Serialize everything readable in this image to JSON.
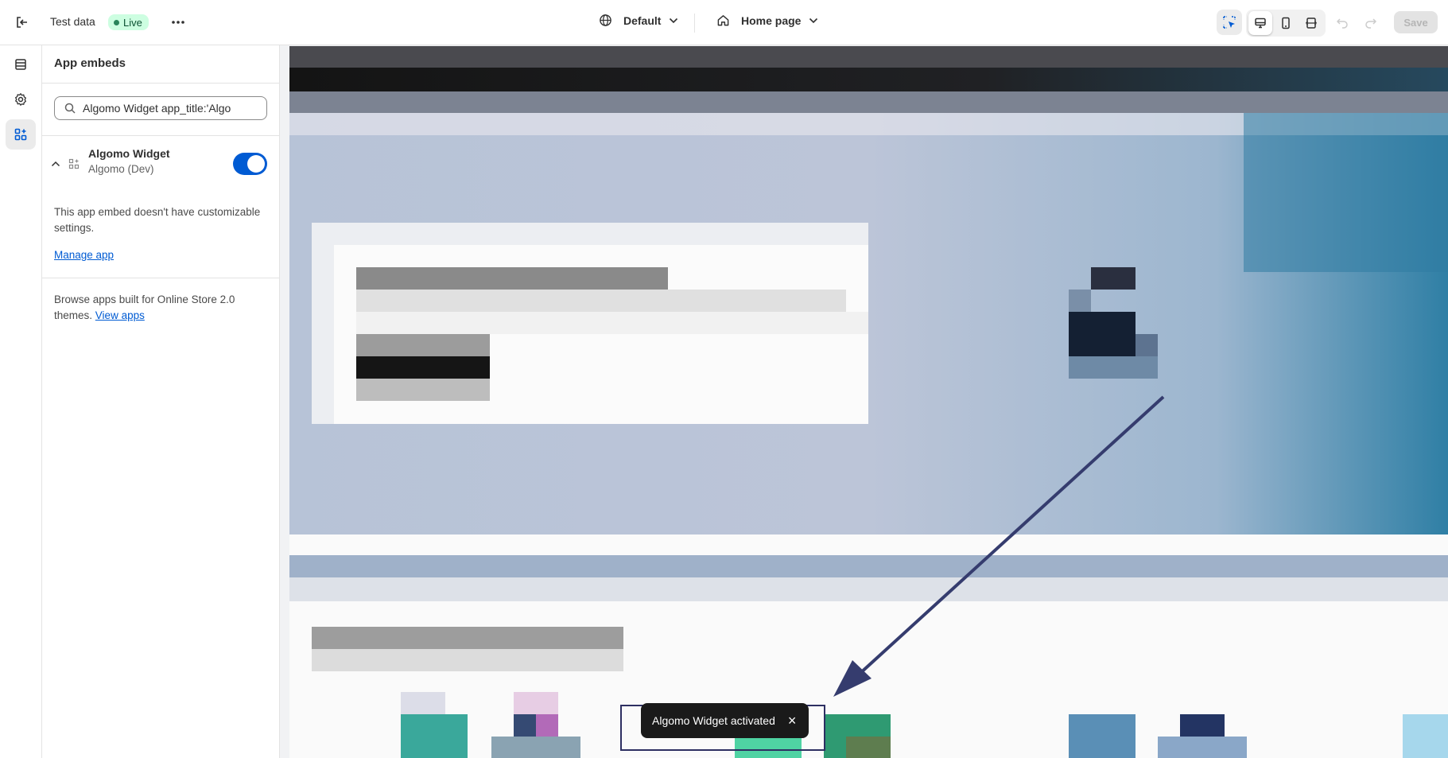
{
  "topbar": {
    "store_name": "Test data",
    "status_badge": "Live",
    "theme": "Default",
    "page": "Home page",
    "save_label": "Save"
  },
  "sidebar": {
    "title": "App embeds",
    "search_value": "Algomo Widget app_title:'Algo",
    "embed": {
      "name": "Algomo Widget",
      "provider": "Algomo (Dev)",
      "enabled": true
    },
    "no_settings_text": "This app embed doesn't have customizable settings.",
    "manage_link": "Manage app",
    "browse_text": "Browse apps built for Online Store 2.0 themes.",
    "view_apps_link": "View apps"
  },
  "toast": {
    "message": "Algomo Widget activated",
    "close_symbol": "×"
  },
  "colors": {
    "accent": "#005bd3",
    "annotation_arrow": "#353c6e",
    "live_badge_bg": "#cdfee1"
  }
}
